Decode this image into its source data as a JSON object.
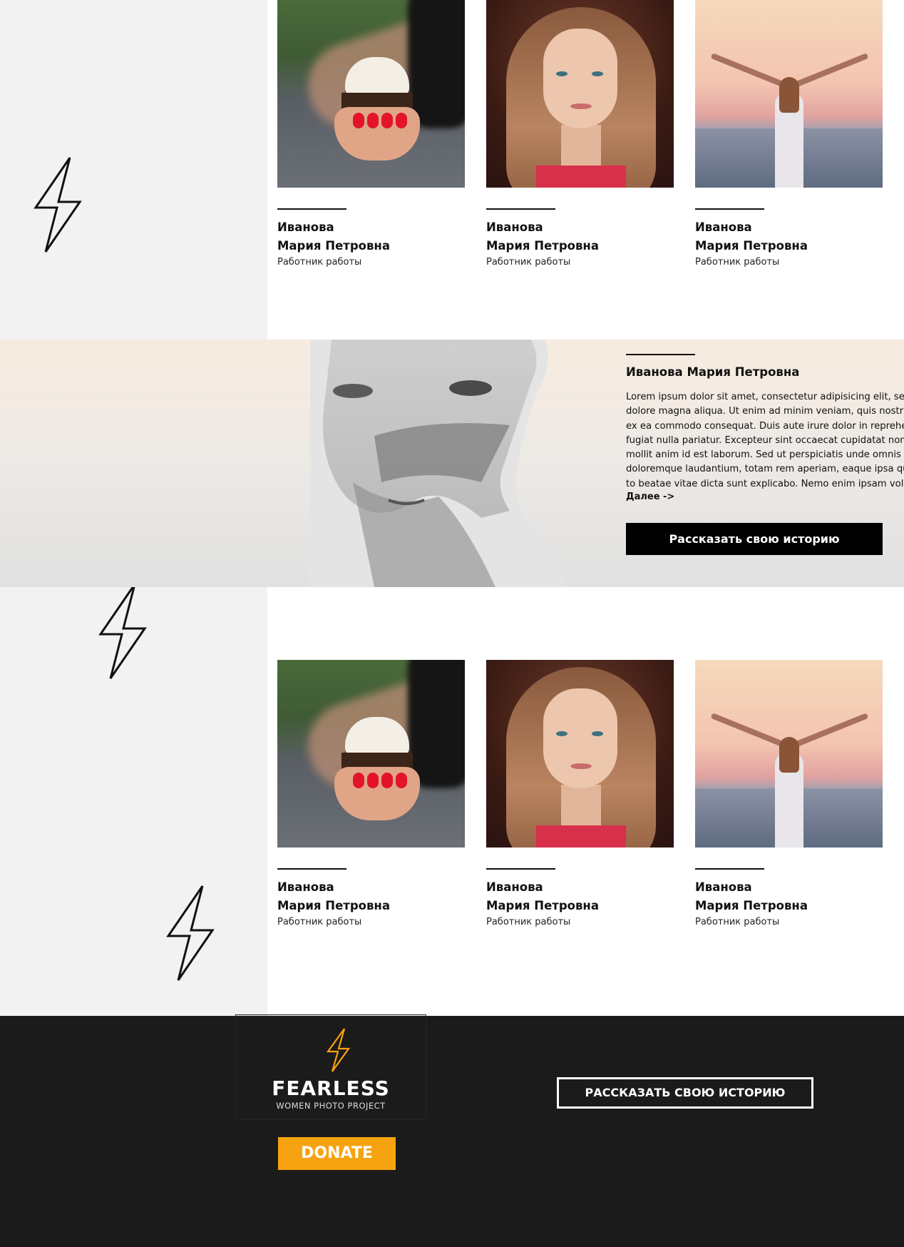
{
  "grid_top": {
    "cards": [
      {
        "surname": "Иванова",
        "given": "Мария Петровна",
        "role": "Работник работы",
        "photo": "cupcake-photo"
      },
      {
        "surname": "Иванова",
        "given": "Мария Петровна",
        "role": "Работник работы",
        "photo": "portrait-photo"
      },
      {
        "surname": "Иванова",
        "given": "Мария Петровна",
        "role": "Работник работы",
        "photo": "sunset-photo"
      }
    ]
  },
  "feature": {
    "title": "Иванова Мария Петровна",
    "lorem_lines": [
      "Lorem ipsum dolor sit amet, consectetur adipisicing elit, sed do",
      "dolore magna aliqua. Ut enim ad minim veniam, quis nostrud",
      "ex ea commodo consequat. Duis aute irure dolor in reprehenderit",
      "fugiat nulla pariatur. Excepteur sint occaecat cupidatat non p",
      "mollit anim id est laborum. Sed ut perspiciatis unde omnis iste",
      "doloremque laudantium, totam rem aperiam, eaque ipsa quae",
      "to beatae vitae dicta sunt explicabo. Nemo enim ipsam volupt"
    ],
    "more_link": "Далее ->",
    "cta_label": "Рассказать свою историю"
  },
  "grid_bottom": {
    "cards": [
      {
        "surname": "Иванова",
        "given": "Мария Петровна",
        "role": "Работник работы",
        "photo": "cupcake-photo"
      },
      {
        "surname": "Иванова",
        "given": "Мария Петровна",
        "role": "Работник работы",
        "photo": "portrait-photo"
      },
      {
        "surname": "Иванова",
        "given": "Мария Петровна",
        "role": "Работник работы",
        "photo": "sunset-photo"
      }
    ]
  },
  "footer": {
    "logo_title": "FEARLESS",
    "logo_subtitle": "WOMEN PHOTO PROJECT",
    "donate_label": "DONATE",
    "cta_label": "РАССКАЗАТЬ СВОЮ ИСТОРИЮ"
  },
  "icons": {
    "decor_bolt": "lightning-bolt-icon",
    "logo_bolt": "lightning-bolt-icon"
  },
  "colors": {
    "accent_orange": "#f6a30f",
    "footer_bg": "#1b1b1b",
    "left_panel_bg": "#f2f2f2",
    "cta_black": "#000000"
  }
}
